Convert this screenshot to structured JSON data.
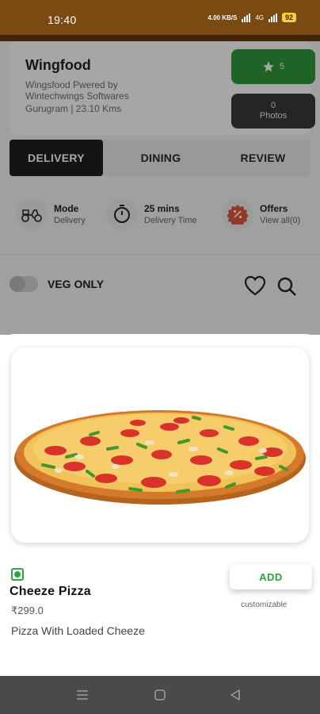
{
  "status_bar": {
    "time": "19:40",
    "network_speed": "4.00 KB/S",
    "network_type": "4G",
    "battery": "92"
  },
  "restaurant": {
    "name": "Wingfood",
    "subtitle": "Wingsfood Pwered by Wintechwings Softwares",
    "location": "Gurugram | 23.10 Kms",
    "rating": "5",
    "photos_count": "0",
    "photos_label": "Photos"
  },
  "tabs": [
    {
      "label": "DELIVERY",
      "active": true
    },
    {
      "label": "DINING",
      "active": false
    },
    {
      "label": "REVIEW",
      "active": false
    }
  ],
  "features": [
    {
      "icon": "scooter-icon",
      "title": "Mode",
      "subtitle": "Delivery"
    },
    {
      "icon": "timer-icon",
      "title": "25 mins",
      "subtitle": "Delivery Time"
    },
    {
      "icon": "offer-badge-icon",
      "title": "Offers",
      "subtitle": "View all(0)"
    }
  ],
  "filter": {
    "veg_only_label": "VEG ONLY",
    "veg_only_on": false
  },
  "item": {
    "name": "Cheeze Pizza",
    "price": "₹299.0",
    "description": "Pizza With Loaded Cheeze",
    "add_label": "ADD",
    "customizable_label": "customizable",
    "image_icon": "pizza-image"
  },
  "colors": {
    "accent_green": "#2aa63c",
    "dark_tab": "#1f1f1f",
    "status_bar": "#7a4a12"
  },
  "navbar": {
    "icons": [
      "menu-icon",
      "home-square-icon",
      "back-triangle-icon"
    ]
  }
}
